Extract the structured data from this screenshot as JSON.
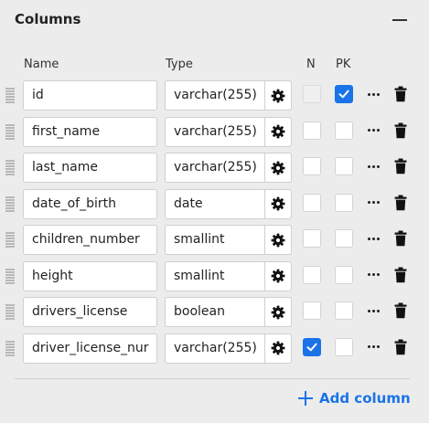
{
  "panel": {
    "title": "Columns",
    "collapse_icon": "minus-icon"
  },
  "headers": {
    "name": "Name",
    "type": "Type",
    "nullable": "N",
    "primary_key": "PK"
  },
  "columns": [
    {
      "name": "id",
      "type": "varchar(255)",
      "nullable": false,
      "nullable_disabled": true,
      "pk": true
    },
    {
      "name": "first_name",
      "type": "varchar(255)",
      "nullable": false,
      "pk": false
    },
    {
      "name": "last_name",
      "type": "varchar(255)",
      "nullable": false,
      "pk": false
    },
    {
      "name": "date_of_birth",
      "type": "date",
      "nullable": false,
      "pk": false
    },
    {
      "name": "children_number",
      "type": "smallint",
      "nullable": false,
      "pk": false
    },
    {
      "name": "height",
      "type": "smallint",
      "nullable": false,
      "pk": false
    },
    {
      "name": "drivers_license",
      "type": "boolean",
      "nullable": false,
      "pk": false
    },
    {
      "name": "driver_license_nur",
      "type": "varchar(255)",
      "nullable": true,
      "pk": false
    }
  ],
  "row_icons": {
    "drag": "drag-handle-icon",
    "type_settings": "gear-icon",
    "more": "more-horizontal-icon",
    "delete": "trash-icon"
  },
  "footer": {
    "add_column_label": "Add column",
    "add_icon": "plus-icon"
  },
  "colors": {
    "accent": "#1a73e8",
    "background": "#ececec"
  }
}
